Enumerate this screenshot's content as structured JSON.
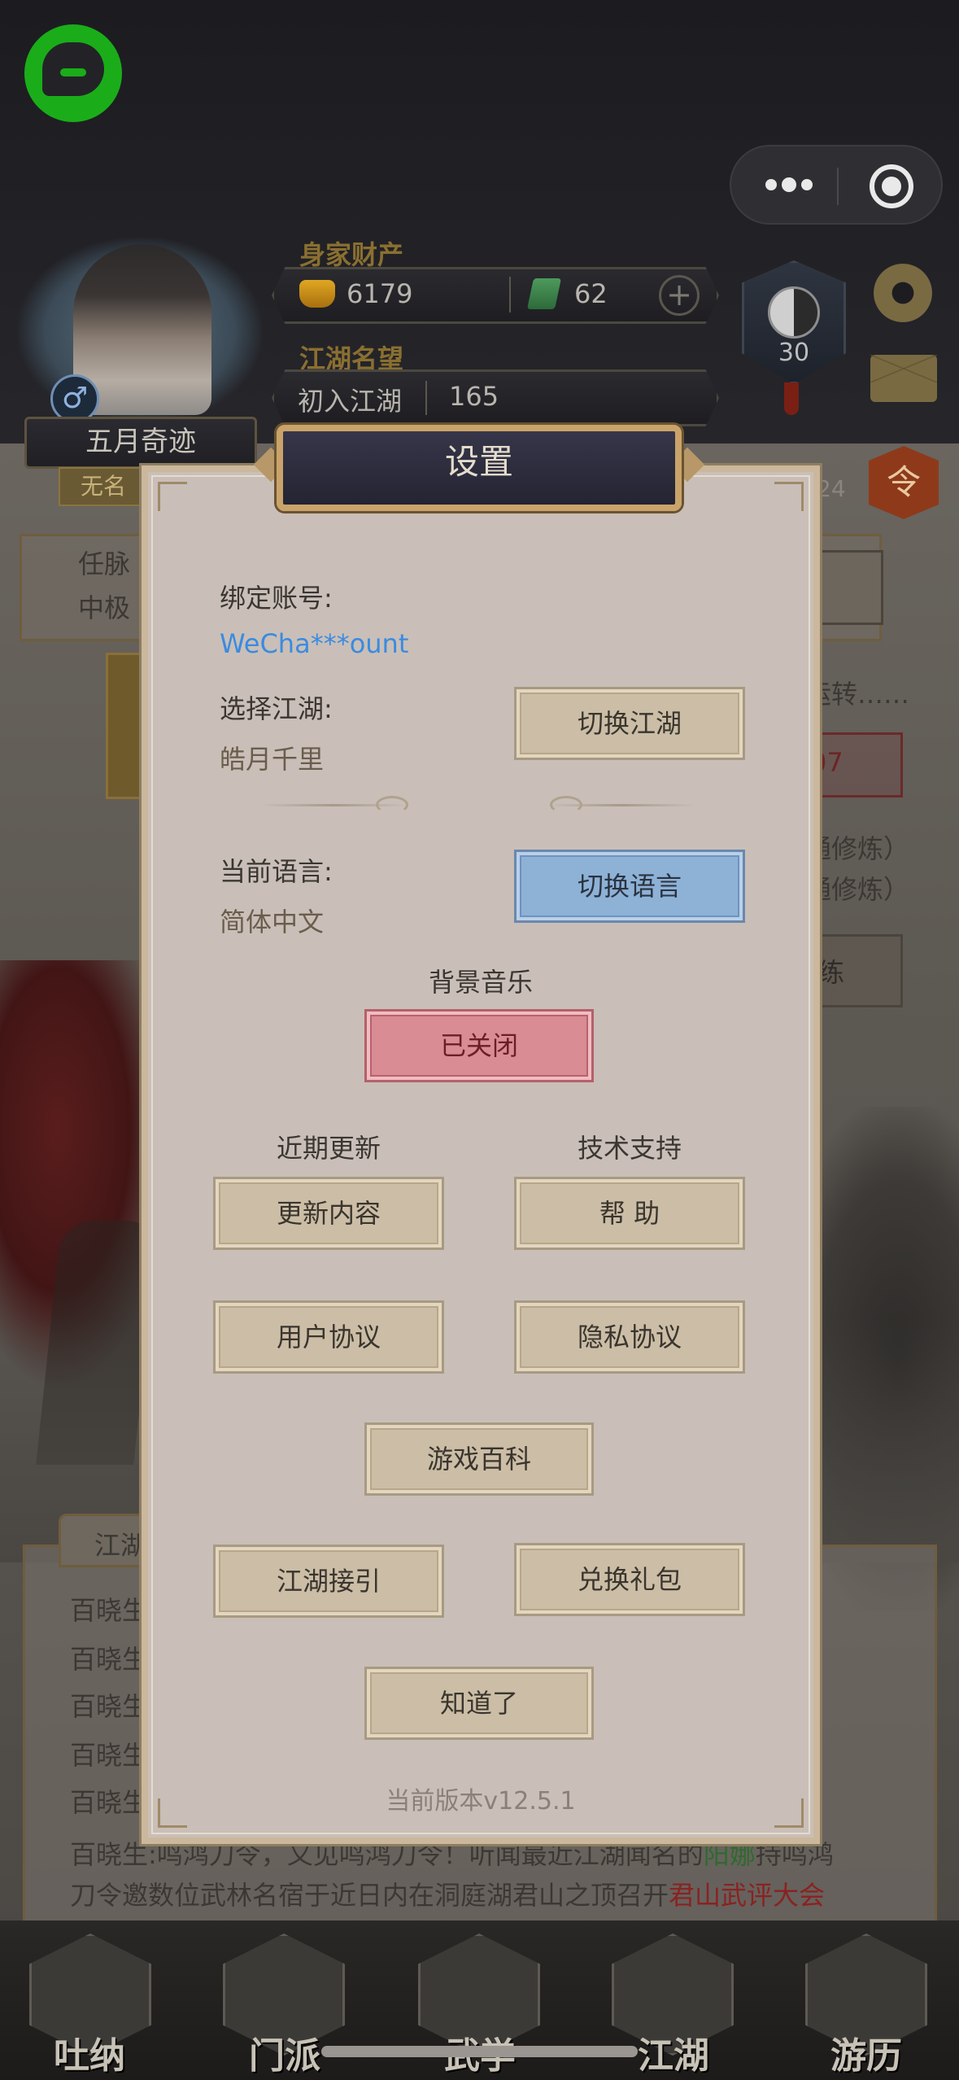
{
  "header": {
    "wealth_label": "身家财产",
    "gold": "6179",
    "jade": "62",
    "plus": "+",
    "fame_label": "江湖名望",
    "fame_rank": "初入江湖",
    "fame_value": "165",
    "player_name": "五月奇迹",
    "player_title": "无名",
    "gender_symbol": "♂",
    "yinyang_level": "30",
    "order_label": "令"
  },
  "background": {
    "panel_lines": [
      "任脉",
      "中极"
    ],
    "right_text_1": "运转……",
    "right_num": "07",
    "right_text_2": "通修炼）",
    "right_text_3": "通修炼）",
    "right_btn": "练",
    "right_small": "24",
    "chat_tab": "江湖",
    "chat_speakers": [
      "百晓生",
      "百晓生",
      "百晓生",
      "百晓生",
      "百晓生"
    ],
    "chat_last_line_1a": "百晓生:鸣鸿刀令，又见鸣鸿刀令！听闻最近江湖闻名的",
    "chat_last_line_1_highlight": "阳娜",
    "chat_last_line_1b": "持鸣鸿",
    "chat_last_line_2a": "刀令邀数位武林名宿于近日内在洞庭湖君山之顶召开",
    "chat_last_line_2_highlight": "君山武评大会"
  },
  "nav": {
    "items": [
      {
        "label": "吐纳"
      },
      {
        "label": "门派"
      },
      {
        "label": "武学"
      },
      {
        "label": "江湖"
      },
      {
        "label": "游历"
      }
    ]
  },
  "dialog": {
    "title": "设置",
    "bind_account_label": "绑定账号:",
    "bind_account_value": "WeCha***ount",
    "select_world_label": "选择江湖:",
    "select_world_value": "皓月千里",
    "switch_world": "切换江湖",
    "language_label": "当前语言:",
    "language_value": "简体中文",
    "switch_language": "切换语言",
    "music_label": "背景音乐",
    "music_state": "已关闭",
    "recent_updates_label": "近期更新",
    "tech_support_label": "技术支持",
    "update_content": "更新内容",
    "help": "帮 助",
    "user_agreement": "用户协议",
    "privacy_agreement": "隐私协议",
    "game_wiki": "游戏百科",
    "jianghu_guide": "江湖接引",
    "redeem_gift": "兑换礼包",
    "got_it": "知道了",
    "version": "当前版本v12.5.1"
  },
  "colors": {
    "dialog_bg": "#c9bfb8",
    "button_bg": "#cbbda6",
    "language_button": "#8eb1d6",
    "music_off_button": "#d98c93",
    "account_link": "#3b8be0"
  }
}
